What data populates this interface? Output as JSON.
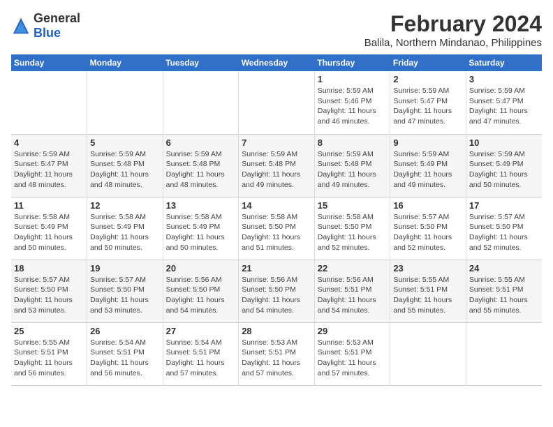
{
  "logo": {
    "text_general": "General",
    "text_blue": "Blue"
  },
  "title": {
    "month": "February 2024",
    "location": "Balila, Northern Mindanao, Philippines"
  },
  "headers": [
    "Sunday",
    "Monday",
    "Tuesday",
    "Wednesday",
    "Thursday",
    "Friday",
    "Saturday"
  ],
  "weeks": [
    [
      {
        "day": "",
        "info": ""
      },
      {
        "day": "",
        "info": ""
      },
      {
        "day": "",
        "info": ""
      },
      {
        "day": "",
        "info": ""
      },
      {
        "day": "1",
        "info": "Sunrise: 5:59 AM\nSunset: 5:46 PM\nDaylight: 11 hours and 46 minutes."
      },
      {
        "day": "2",
        "info": "Sunrise: 5:59 AM\nSunset: 5:47 PM\nDaylight: 11 hours and 47 minutes."
      },
      {
        "day": "3",
        "info": "Sunrise: 5:59 AM\nSunset: 5:47 PM\nDaylight: 11 hours and 47 minutes."
      }
    ],
    [
      {
        "day": "4",
        "info": "Sunrise: 5:59 AM\nSunset: 5:47 PM\nDaylight: 11 hours and 48 minutes."
      },
      {
        "day": "5",
        "info": "Sunrise: 5:59 AM\nSunset: 5:48 PM\nDaylight: 11 hours and 48 minutes."
      },
      {
        "day": "6",
        "info": "Sunrise: 5:59 AM\nSunset: 5:48 PM\nDaylight: 11 hours and 48 minutes."
      },
      {
        "day": "7",
        "info": "Sunrise: 5:59 AM\nSunset: 5:48 PM\nDaylight: 11 hours and 49 minutes."
      },
      {
        "day": "8",
        "info": "Sunrise: 5:59 AM\nSunset: 5:48 PM\nDaylight: 11 hours and 49 minutes."
      },
      {
        "day": "9",
        "info": "Sunrise: 5:59 AM\nSunset: 5:49 PM\nDaylight: 11 hours and 49 minutes."
      },
      {
        "day": "10",
        "info": "Sunrise: 5:59 AM\nSunset: 5:49 PM\nDaylight: 11 hours and 50 minutes."
      }
    ],
    [
      {
        "day": "11",
        "info": "Sunrise: 5:58 AM\nSunset: 5:49 PM\nDaylight: 11 hours and 50 minutes."
      },
      {
        "day": "12",
        "info": "Sunrise: 5:58 AM\nSunset: 5:49 PM\nDaylight: 11 hours and 50 minutes."
      },
      {
        "day": "13",
        "info": "Sunrise: 5:58 AM\nSunset: 5:49 PM\nDaylight: 11 hours and 50 minutes."
      },
      {
        "day": "14",
        "info": "Sunrise: 5:58 AM\nSunset: 5:50 PM\nDaylight: 11 hours and 51 minutes."
      },
      {
        "day": "15",
        "info": "Sunrise: 5:58 AM\nSunset: 5:50 PM\nDaylight: 11 hours and 52 minutes."
      },
      {
        "day": "16",
        "info": "Sunrise: 5:57 AM\nSunset: 5:50 PM\nDaylight: 11 hours and 52 minutes."
      },
      {
        "day": "17",
        "info": "Sunrise: 5:57 AM\nSunset: 5:50 PM\nDaylight: 11 hours and 52 minutes."
      }
    ],
    [
      {
        "day": "18",
        "info": "Sunrise: 5:57 AM\nSunset: 5:50 PM\nDaylight: 11 hours and 53 minutes."
      },
      {
        "day": "19",
        "info": "Sunrise: 5:57 AM\nSunset: 5:50 PM\nDaylight: 11 hours and 53 minutes."
      },
      {
        "day": "20",
        "info": "Sunrise: 5:56 AM\nSunset: 5:50 PM\nDaylight: 11 hours and 54 minutes."
      },
      {
        "day": "21",
        "info": "Sunrise: 5:56 AM\nSunset: 5:50 PM\nDaylight: 11 hours and 54 minutes."
      },
      {
        "day": "22",
        "info": "Sunrise: 5:56 AM\nSunset: 5:51 PM\nDaylight: 11 hours and 54 minutes."
      },
      {
        "day": "23",
        "info": "Sunrise: 5:55 AM\nSunset: 5:51 PM\nDaylight: 11 hours and 55 minutes."
      },
      {
        "day": "24",
        "info": "Sunrise: 5:55 AM\nSunset: 5:51 PM\nDaylight: 11 hours and 55 minutes."
      }
    ],
    [
      {
        "day": "25",
        "info": "Sunrise: 5:55 AM\nSunset: 5:51 PM\nDaylight: 11 hours and 56 minutes."
      },
      {
        "day": "26",
        "info": "Sunrise: 5:54 AM\nSunset: 5:51 PM\nDaylight: 11 hours and 56 minutes."
      },
      {
        "day": "27",
        "info": "Sunrise: 5:54 AM\nSunset: 5:51 PM\nDaylight: 11 hours and 57 minutes."
      },
      {
        "day": "28",
        "info": "Sunrise: 5:53 AM\nSunset: 5:51 PM\nDaylight: 11 hours and 57 minutes."
      },
      {
        "day": "29",
        "info": "Sunrise: 5:53 AM\nSunset: 5:51 PM\nDaylight: 11 hours and 57 minutes."
      },
      {
        "day": "",
        "info": ""
      },
      {
        "day": "",
        "info": ""
      }
    ]
  ]
}
